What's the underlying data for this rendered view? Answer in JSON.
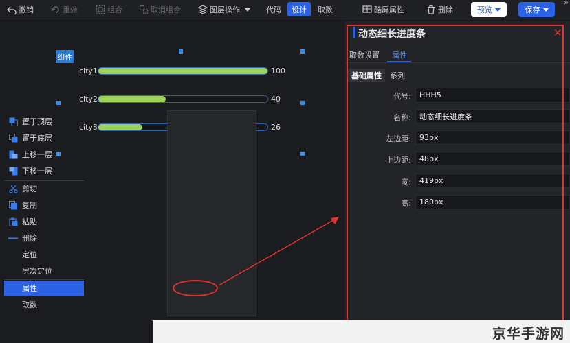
{
  "toolbar": {
    "undo": "撤销",
    "redo": "重做",
    "group": "组合",
    "ungroup": "取消组合",
    "layer_ops": "图层操作",
    "mode_code": "代码",
    "mode_design": "设计",
    "mode_data": "取数",
    "fullscreen_props": "酷屏属性",
    "delete": "删除",
    "preview": "预览",
    "save": "保存",
    "expand": "»"
  },
  "canvas": {
    "badge": "组件",
    "rows": [
      {
        "label": "city1",
        "value": 100,
        "value_text": "100"
      },
      {
        "label": "city2",
        "value": 40,
        "value_text": "40"
      },
      {
        "label": "city3",
        "value": 26,
        "value_text": "26"
      }
    ],
    "bar_color": "#9bd35b",
    "max": 100
  },
  "context_menu": {
    "items": [
      {
        "label": "置于顶层",
        "icon": "bring-to-front-icon"
      },
      {
        "label": "置于底层",
        "icon": "send-to-back-icon"
      },
      {
        "label": "上移一层",
        "icon": "move-up-icon"
      },
      {
        "label": "下移一层",
        "icon": "move-down-icon"
      },
      {
        "label": "剪切",
        "icon": "scissors-icon"
      },
      {
        "label": "复制",
        "icon": "copy-icon"
      },
      {
        "label": "粘贴",
        "icon": "paste-icon"
      },
      {
        "label": "删除",
        "icon": "minus-icon"
      },
      {
        "label": "定位",
        "icon": ""
      },
      {
        "label": "层次定位",
        "icon": ""
      },
      {
        "label": "属性",
        "icon": "",
        "highlighted": true
      },
      {
        "label": "取数",
        "icon": ""
      }
    ]
  },
  "panel": {
    "title": "动态细长进度条",
    "tabs": [
      "取数设置",
      "属性"
    ],
    "active_tab": "属性",
    "subtabs": [
      "基础属性",
      "系列"
    ],
    "fields": [
      {
        "label": "代号:",
        "value": "HHH5"
      },
      {
        "label": "名称:",
        "value": "动态细长进度条"
      },
      {
        "label": "左边距:",
        "value": "93px"
      },
      {
        "label": "上边距:",
        "value": "48px"
      },
      {
        "label": "宽:",
        "value": "419px"
      },
      {
        "label": "高:",
        "value": "180px"
      }
    ]
  },
  "watermark": "京华手游网",
  "accent_color": "#2b62e6",
  "annotation_color": "#e6322c"
}
